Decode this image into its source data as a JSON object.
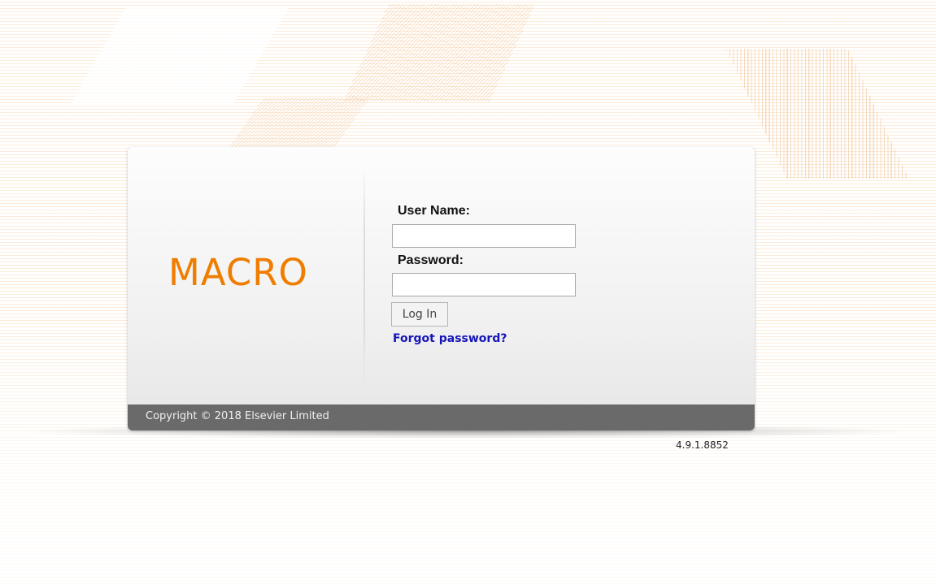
{
  "brand": {
    "logo_text": "MACRO",
    "accent_color": "#ef7d00"
  },
  "login_form": {
    "username_label": "User Name:",
    "username_value": "",
    "password_label": "Password:",
    "password_value": "",
    "login_button_label": "Log In",
    "forgot_password_label": "Forgot password?"
  },
  "footer": {
    "copyright": "Copyright © 2018 Elsevier Limited"
  },
  "version": "4.9.1.8852"
}
